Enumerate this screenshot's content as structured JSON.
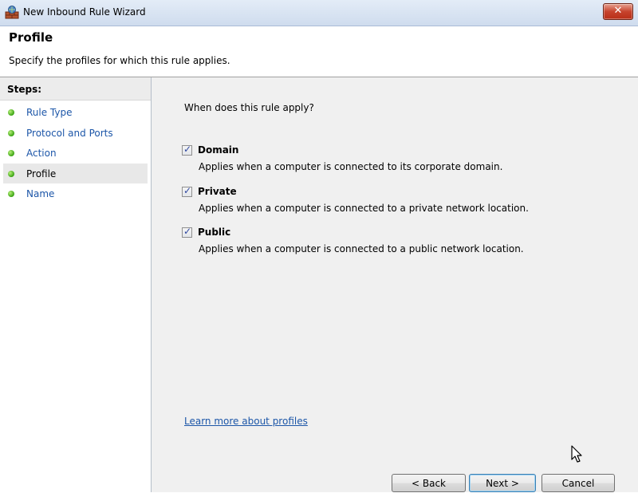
{
  "window": {
    "title": "New Inbound Rule Wizard",
    "close_label": "✕"
  },
  "header": {
    "title": "Profile",
    "subtitle": "Specify the profiles for which this rule applies."
  },
  "steps": {
    "heading": "Steps:",
    "items": [
      {
        "label": "Rule Type"
      },
      {
        "label": "Protocol and Ports"
      },
      {
        "label": "Action"
      },
      {
        "label": "Profile"
      },
      {
        "label": "Name"
      }
    ]
  },
  "main": {
    "question": "When does this rule apply?",
    "options": [
      {
        "label": "Domain",
        "description": "Applies when a computer is connected to its corporate domain.",
        "checked": true
      },
      {
        "label": "Private",
        "description": "Applies when a computer is connected to a private network location.",
        "checked": true
      },
      {
        "label": "Public",
        "description": "Applies when a computer is connected to a public network location.",
        "checked": true
      }
    ],
    "checkmark": "✓",
    "learn_more": "Learn more about profiles"
  },
  "buttons": {
    "back": "< Back",
    "next": "Next >",
    "cancel": "Cancel"
  }
}
